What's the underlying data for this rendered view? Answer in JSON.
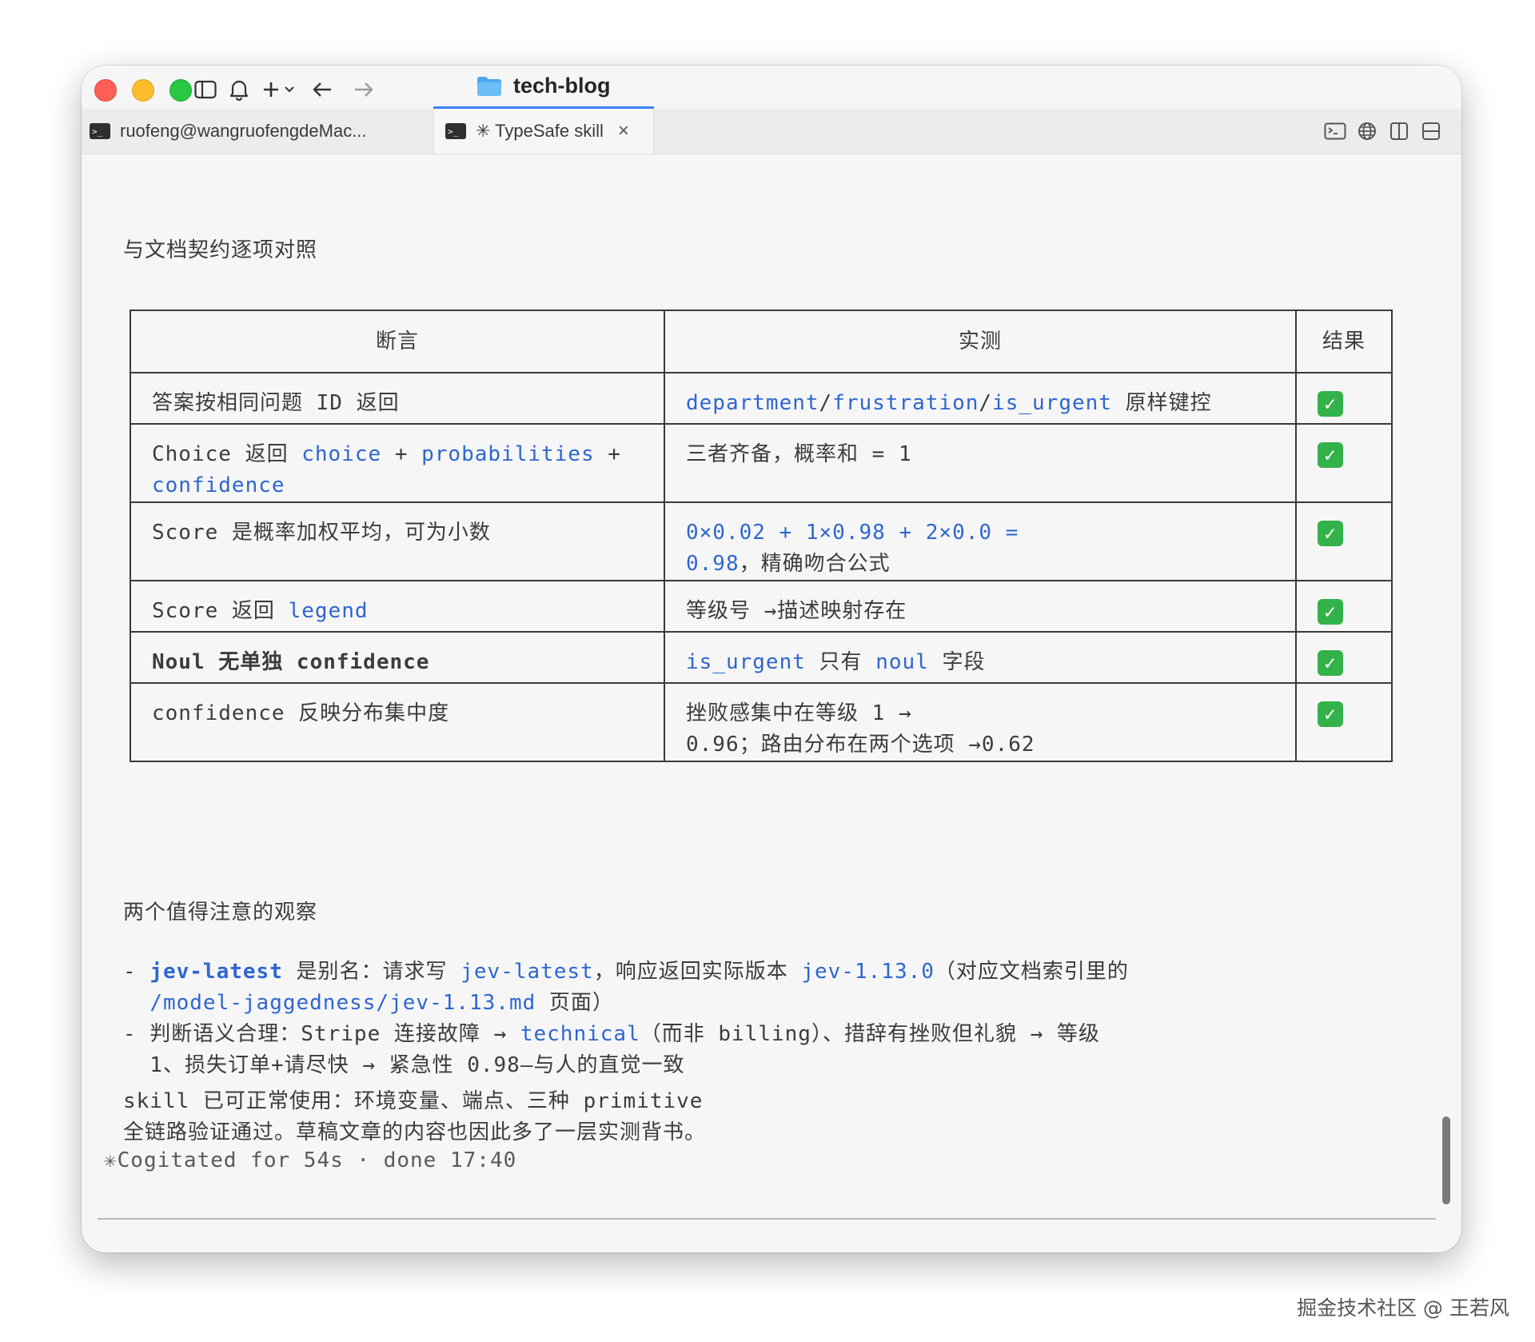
{
  "window": {
    "title": "tech-blog",
    "tabs": [
      {
        "label": "ruofeng@wangruofengdeMac...",
        "active": false
      },
      {
        "label": "✳ TypeSafe skill",
        "active": true,
        "close": "×"
      }
    ]
  },
  "content": {
    "heading": "与文档契约逐项对照",
    "table": {
      "headers": [
        "断言",
        "实测",
        "结果"
      ],
      "check": "✓",
      "rows": [
        {
          "a": [
            {
              "t": "答案按相同问题 ID 返回"
            }
          ],
          "m": [
            {
              "t": "department",
              "k": 1
            },
            {
              "t": "/"
            },
            {
              "t": "frustration",
              "k": 1
            },
            {
              "t": "/"
            },
            {
              "t": "is_urgent",
              "k": 1
            },
            {
              "t": " 原样键控"
            }
          ]
        },
        {
          "a": [
            {
              "t": "Choice 返回 "
            },
            {
              "t": "choice",
              "k": 1
            },
            {
              "t": " + "
            },
            {
              "t": "probabilities",
              "k": 1
            },
            {
              "t": " + "
            },
            {
              "br": 1
            },
            {
              "t": " "
            },
            {
              "t": "confidence",
              "k": 1
            }
          ],
          "m": [
            {
              "t": "三者齐备，概率和 = 1"
            }
          ]
        },
        {
          "a": [
            {
              "t": "Score 是概率加权平均，可为小数"
            }
          ],
          "m": [
            {
              "t": "0×0.02 + 1×0.98 + 2×0.0 =",
              "k": 1
            },
            {
              "br": 1
            },
            {
              "t": "0.98",
              "k": 1
            },
            {
              "t": "，精确吻合公式"
            }
          ]
        },
        {
          "a": [
            {
              "t": "Score 返回 "
            },
            {
              "t": "legend",
              "k": 1
            }
          ],
          "m": [
            {
              "t": "等级号 →描述映射存在"
            }
          ]
        },
        {
          "a": [
            {
              "t": "Noul 无单独 confidence",
              "b": 1
            }
          ],
          "m": [
            {
              "t": "is_urgent",
              "k": 1
            },
            {
              "t": " 只有 "
            },
            {
              "t": "noul",
              "k": 1
            },
            {
              "t": " 字段"
            }
          ]
        },
        {
          "a": [
            {
              "t": "confidence 反映分布集中度"
            }
          ],
          "m": [
            {
              "t": "挫败感集中在等级 1 →"
            },
            {
              "br": 1
            },
            {
              "t": "0.96；路由分布在两个选项 →0.62"
            }
          ]
        }
      ]
    },
    "observations_heading": "两个值得注意的观察",
    "observations": [
      [
        {
          "t": "- "
        },
        {
          "t": "jev-latest",
          "kb": 1
        },
        {
          "t": " 是别名：请求写 "
        },
        {
          "t": "jev-latest",
          "k": 1
        },
        {
          "t": "，响应返回实际版本 "
        },
        {
          "t": "jev-1.13.0",
          "k": 1
        },
        {
          "t": "（对应文档索引里的"
        }
      ],
      [
        {
          "t": "  "
        },
        {
          "t": "/model-jaggedness/jev-1.13.md",
          "k": 1
        },
        {
          "t": " 页面）"
        }
      ],
      [
        {
          "t": "- 判断语义合理：Stripe 连接故障 → "
        },
        {
          "t": "technical",
          "k": 1
        },
        {
          "t": "（而非 billing）、措辞有挫败但礼貌 → 等级"
        }
      ],
      [
        {
          "t": "  1、损失订单+请尽快 → 紧急性 0.98—与人的直觉一致"
        }
      ]
    ],
    "summary": [
      "skill 已可正常使用：环境变量、端点、三种 primitive",
      "全链路验证通过。草稿文章的内容也因此多了一层实测背书。"
    ],
    "status": "✳Cogitated for 54s · done 17:40"
  },
  "watermark": "掘金技术社区 @ 王若风",
  "icons": [
    "sidebar-toggle-icon",
    "bell-icon",
    "plus-icon",
    "chevron-down-icon",
    "arrow-left-icon",
    "arrow-right-icon",
    "folder-icon",
    "terminal-icon",
    "globe-icon",
    "split-vertical-icon",
    "split-horizontal-icon"
  ],
  "colors": {
    "accent": "#3b82f6",
    "keyword": "#2f66d0",
    "check": "#33b24a",
    "folder": "#4aa8f0"
  }
}
